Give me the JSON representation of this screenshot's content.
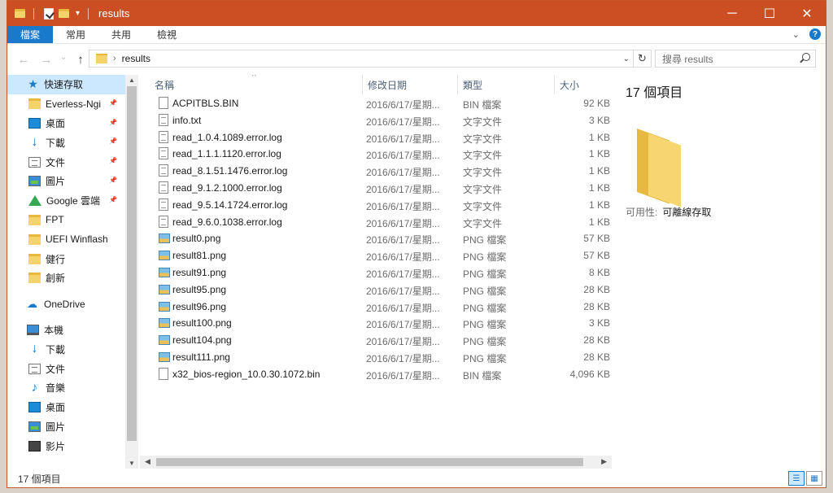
{
  "window": {
    "title": "results"
  },
  "ribbon": {
    "tabs": [
      "檔案",
      "常用",
      "共用",
      "檢視"
    ],
    "help": "?"
  },
  "address": {
    "path": "results",
    "search_placeholder": "搜尋 results"
  },
  "nav": {
    "items": [
      {
        "label": "快速存取",
        "icon": "star-icon",
        "hdr": true,
        "sel": true
      },
      {
        "label": "Everless-Ngi",
        "icon": "folder-icon",
        "pin": true
      },
      {
        "label": "桌面",
        "icon": "desktop-icon",
        "pin": true
      },
      {
        "label": "下載",
        "icon": "download-icon",
        "pin": true
      },
      {
        "label": "文件",
        "icon": "document-icon",
        "pin": true
      },
      {
        "label": "圖片",
        "icon": "picture-icon",
        "pin": true
      },
      {
        "label": "Google 雲端",
        "icon": "google-drive-icon",
        "pin": true
      },
      {
        "label": "FPT",
        "icon": "folder-icon"
      },
      {
        "label": "UEFI Winflash",
        "icon": "folder-icon"
      },
      {
        "label": "健行",
        "icon": "folder-icon"
      },
      {
        "label": "創新",
        "icon": "folder-icon"
      },
      {
        "label": "",
        "icon": "",
        "spacer": true
      },
      {
        "label": "OneDrive",
        "icon": "onedrive-icon",
        "hdr": true
      },
      {
        "label": "",
        "icon": "",
        "spacer": true
      },
      {
        "label": "本機",
        "icon": "this-pc-icon",
        "hdr": true
      },
      {
        "label": "下載",
        "icon": "download-icon"
      },
      {
        "label": "文件",
        "icon": "document-icon"
      },
      {
        "label": "音樂",
        "icon": "music-icon"
      },
      {
        "label": "桌面",
        "icon": "desktop-icon"
      },
      {
        "label": "圖片",
        "icon": "picture-icon"
      },
      {
        "label": "影片",
        "icon": "video-icon"
      }
    ]
  },
  "columns": {
    "name": "名稱",
    "date": "修改日期",
    "type": "類型",
    "size": "大小"
  },
  "files": [
    {
      "name": "ACPITBLS.BIN",
      "date": "2016/6/17/星期...",
      "type": "BIN 檔案",
      "size": "92 KB",
      "kind": "doc"
    },
    {
      "name": "info.txt",
      "date": "2016/6/17/星期...",
      "type": "文字文件",
      "size": "3 KB",
      "kind": "txt"
    },
    {
      "name": "read_1.0.4.1089.error.log",
      "date": "2016/6/17/星期...",
      "type": "文字文件",
      "size": "1 KB",
      "kind": "txt"
    },
    {
      "name": "read_1.1.1.1120.error.log",
      "date": "2016/6/17/星期...",
      "type": "文字文件",
      "size": "1 KB",
      "kind": "txt"
    },
    {
      "name": "read_8.1.51.1476.error.log",
      "date": "2016/6/17/星期...",
      "type": "文字文件",
      "size": "1 KB",
      "kind": "txt"
    },
    {
      "name": "read_9.1.2.1000.error.log",
      "date": "2016/6/17/星期...",
      "type": "文字文件",
      "size": "1 KB",
      "kind": "txt"
    },
    {
      "name": "read_9.5.14.1724.error.log",
      "date": "2016/6/17/星期...",
      "type": "文字文件",
      "size": "1 KB",
      "kind": "txt"
    },
    {
      "name": "read_9.6.0.1038.error.log",
      "date": "2016/6/17/星期...",
      "type": "文字文件",
      "size": "1 KB",
      "kind": "txt"
    },
    {
      "name": "result0.png",
      "date": "2016/6/17/星期...",
      "type": "PNG 檔案",
      "size": "57 KB",
      "kind": "png"
    },
    {
      "name": "result81.png",
      "date": "2016/6/17/星期...",
      "type": "PNG 檔案",
      "size": "57 KB",
      "kind": "png"
    },
    {
      "name": "result91.png",
      "date": "2016/6/17/星期...",
      "type": "PNG 檔案",
      "size": "8 KB",
      "kind": "png"
    },
    {
      "name": "result95.png",
      "date": "2016/6/17/星期...",
      "type": "PNG 檔案",
      "size": "28 KB",
      "kind": "png"
    },
    {
      "name": "result96.png",
      "date": "2016/6/17/星期...",
      "type": "PNG 檔案",
      "size": "28 KB",
      "kind": "png"
    },
    {
      "name": "result100.png",
      "date": "2016/6/17/星期...",
      "type": "PNG 檔案",
      "size": "3 KB",
      "kind": "png"
    },
    {
      "name": "result104.png",
      "date": "2016/6/17/星期...",
      "type": "PNG 檔案",
      "size": "28 KB",
      "kind": "png"
    },
    {
      "name": "result111.png",
      "date": "2016/6/17/星期...",
      "type": "PNG 檔案",
      "size": "28 KB",
      "kind": "png"
    },
    {
      "name": "x32_bios-region_10.0.30.1072.bin",
      "date": "2016/6/17/星期...",
      "type": "BIN 檔案",
      "size": "4,096 KB",
      "kind": "doc"
    }
  ],
  "details": {
    "count": "17 個項目",
    "availability_label": "可用性:",
    "availability_value": "可離線存取"
  },
  "status": {
    "text": "17 個項目"
  },
  "colors": {
    "titlebar": "#cb4f22",
    "accent": "#1979ca",
    "selection": "#cce8ff"
  }
}
